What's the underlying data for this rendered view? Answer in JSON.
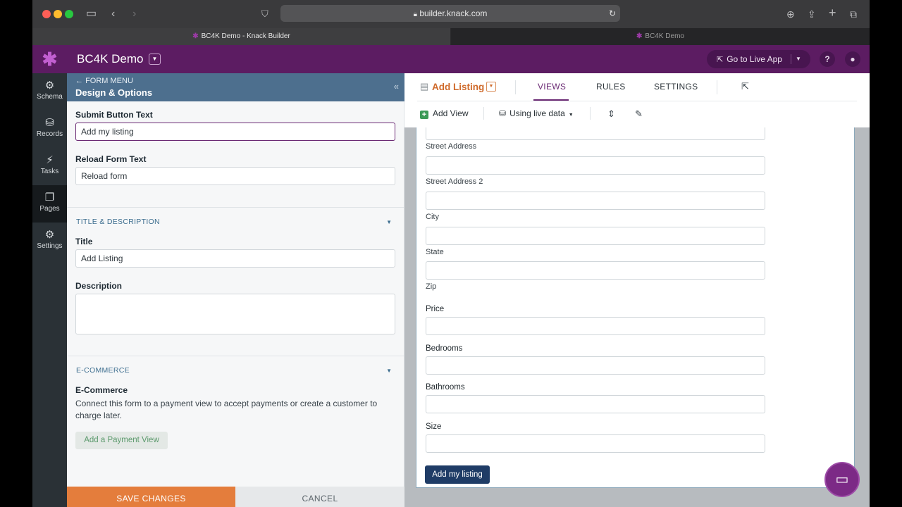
{
  "browser": {
    "url": "builder.knack.com",
    "tabs": [
      {
        "label": "BC4K Demo - Knack Builder"
      },
      {
        "label": "BC4K Demo"
      }
    ]
  },
  "app": {
    "name": "BC4K Demo",
    "go_live_label": "Go to Live App",
    "brand_color": "#5c1c62"
  },
  "nav": {
    "items": [
      {
        "label": "Schema",
        "icon": "schema-icon"
      },
      {
        "label": "Records",
        "icon": "database-icon"
      },
      {
        "label": "Tasks",
        "icon": "bolt-icon"
      },
      {
        "label": "Pages",
        "icon": "pages-icon"
      },
      {
        "label": "Settings",
        "icon": "gear-icon"
      }
    ],
    "active": "Pages"
  },
  "panel": {
    "back_label": "FORM MENU",
    "title": "Design & Options",
    "submit_label": "Submit Button Text",
    "submit_value": "Add my listing",
    "reload_label": "Reload Form Text",
    "reload_value": "Reload form",
    "section_title_desc": "TITLE & DESCRIPTION",
    "title_label": "Title",
    "title_value": "Add Listing",
    "description_label": "Description",
    "section_ecommerce": "E-COMMERCE",
    "ecommerce_label": "E-Commerce",
    "ecommerce_text": "Connect this form to a payment view to accept payments or create a customer to charge later.",
    "payment_button": "Add a Payment View",
    "save_label": "SAVE CHANGES",
    "cancel_label": "CANCEL"
  },
  "main": {
    "page_title": "Add Listing",
    "tabs": [
      {
        "label": "VIEWS"
      },
      {
        "label": "RULES"
      },
      {
        "label": "SETTINGS"
      }
    ],
    "active_tab": "VIEWS",
    "add_view_label": "Add View",
    "live_data_label": "Using live data"
  },
  "form": {
    "fields": [
      {
        "label": "Street Address"
      },
      {
        "label": "Street Address 2"
      },
      {
        "label": "City"
      },
      {
        "label": "State"
      },
      {
        "label": "Zip"
      },
      {
        "label": "Price"
      },
      {
        "label": "Bedrooms"
      },
      {
        "label": "Bathrooms"
      },
      {
        "label": "Size"
      }
    ],
    "submit_button": "Add my listing"
  }
}
